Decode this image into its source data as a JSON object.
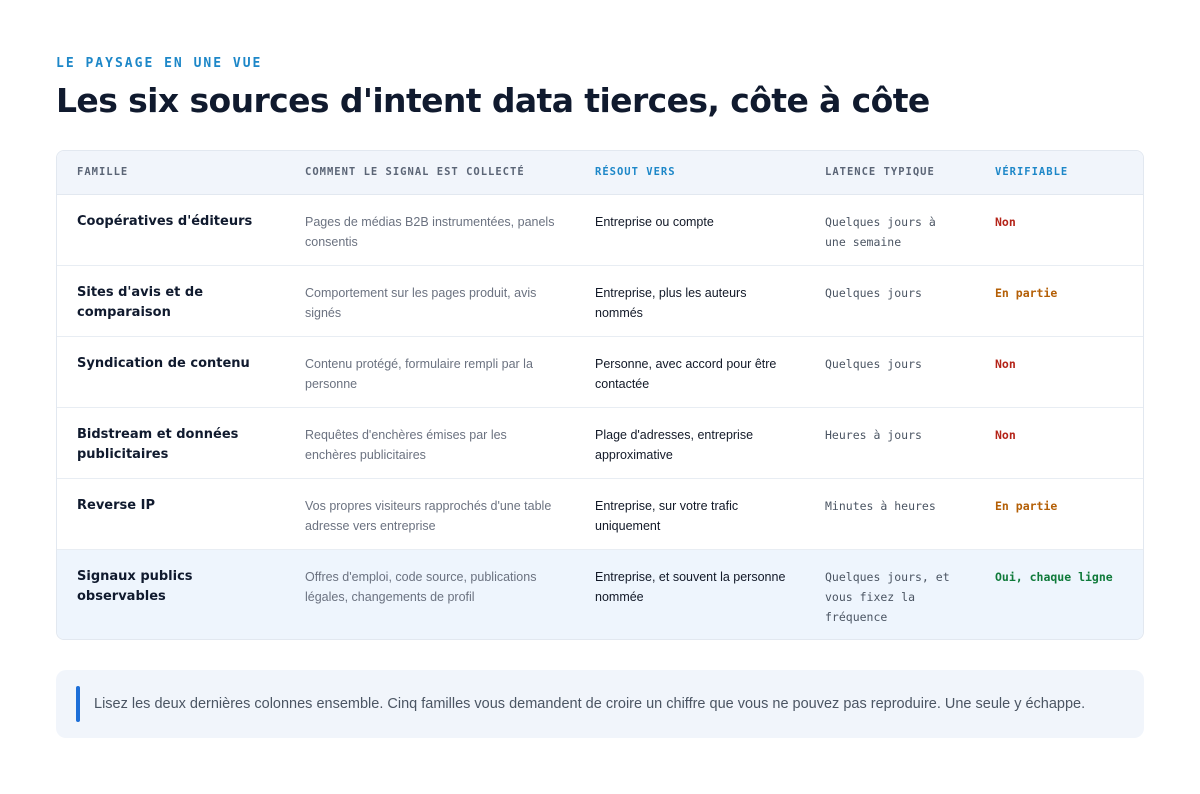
{
  "header": {
    "eyebrow": "LE PAYSAGE EN UNE VUE",
    "title": "Les six sources d'intent data tierces, côte à côte"
  },
  "table": {
    "columns": [
      {
        "label": "FAMILLE",
        "accent": false
      },
      {
        "label": "COMMENT LE SIGNAL EST COLLECTÉ",
        "accent": false
      },
      {
        "label": "RÉSOUT VERS",
        "accent": true
      },
      {
        "label": "LATENCE TYPIQUE",
        "accent": false
      },
      {
        "label": "VÉRIFIABLE",
        "accent": true
      }
    ],
    "rows": [
      {
        "family": "Coopératives d'éditeurs",
        "collection": "Pages de médias B2B instrumentées, panels consentis",
        "resolves": "Entreprise ou compte",
        "latency": "Quelques jours à une semaine",
        "verifiable": "Non",
        "status": "no"
      },
      {
        "family": "Sites d'avis et de comparaison",
        "collection": "Comportement sur les pages produit, avis signés",
        "resolves": "Entreprise, plus les auteurs nommés",
        "latency": "Quelques jours",
        "verifiable": "En partie",
        "status": "part"
      },
      {
        "family": "Syndication de contenu",
        "collection": "Contenu protégé, formulaire rempli par la personne",
        "resolves": "Personne, avec accord pour être contactée",
        "latency": "Quelques jours",
        "verifiable": "Non",
        "status": "no"
      },
      {
        "family": "Bidstream et données publicitaires",
        "collection": "Requêtes d'enchères émises par les enchères publicitaires",
        "resolves": "Plage d'adresses, entreprise approximative",
        "latency": "Heures à jours",
        "verifiable": "Non",
        "status": "no"
      },
      {
        "family": "Reverse IP",
        "collection": "Vos propres visiteurs rapprochés d'une table adresse vers entreprise",
        "resolves": "Entreprise, sur votre trafic uniquement",
        "latency": "Minutes à heures",
        "verifiable": "En partie",
        "status": "part"
      },
      {
        "family": "Signaux publics observables",
        "collection": "Offres d'emploi, code source, publications légales, changements de profil",
        "resolves": "Entreprise, et souvent la personne nommée",
        "latency": "Quelques jours, et vous fixez la fréquence",
        "verifiable": "Oui, chaque ligne",
        "status": "yes",
        "highlight": true
      }
    ]
  },
  "callout": {
    "text": "Lisez les deux dernières colonnes ensemble. Cinq familles vous demandent de croire un chiffre que vous ne pouvez pas reproduire. Une seule y échappe."
  },
  "colors": {
    "accent": "#1d87c8",
    "no": "#b42318",
    "part": "#b45f06",
    "yes": "#0f7a3a",
    "highlight_row": "#eef5fd"
  }
}
